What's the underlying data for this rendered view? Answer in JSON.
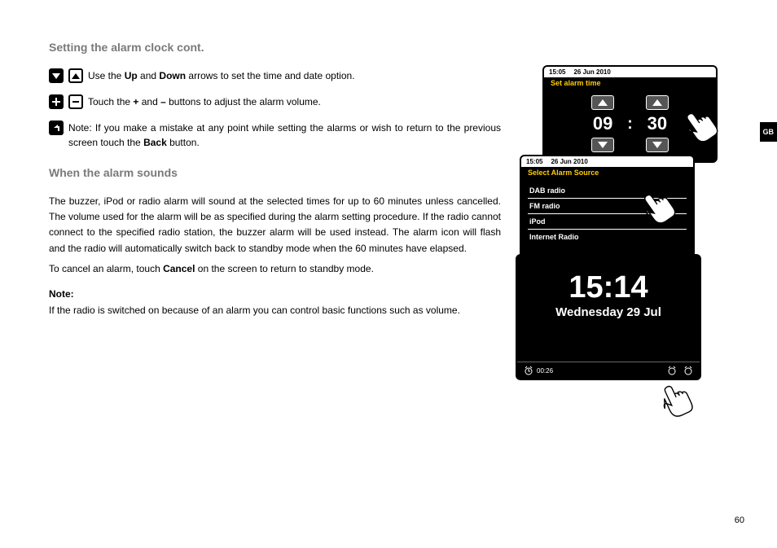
{
  "titles": {
    "section1": "Setting the alarm clock cont.",
    "section2": "When the alarm sounds"
  },
  "instructions": {
    "updown_pre": "Use the ",
    "updown_b1": "Up",
    "updown_mid": " and ",
    "updown_b2": "Down",
    "updown_post": " arrows to set the time and date option.",
    "plusminus_pre": "Touch the ",
    "plusminus_b1": "+",
    "plusminus_mid": " and ",
    "plusminus_b2": "–",
    "plusminus_post": " buttons to adjust the alarm volume.",
    "back_pre": "Note: If you make a mistake at any point while setting the alarms or wish to return to the previous screen touch the ",
    "back_b": "Back",
    "back_post": " button."
  },
  "body": {
    "p1": "The buzzer, iPod or radio alarm will sound at the selected times for up to 60 minutes unless cancelled. The volume used for the alarm will be as specified during the alarm setting procedure. If the radio cannot connect to the specified radio station, the buzzer alarm will be used instead. The alarm icon will flash and the radio will automatically switch back to standby mode when the 60 minutes have elapsed.",
    "p2_pre": "To cancel an alarm, touch ",
    "p2_b": "Cancel",
    "p2_post": " on the screen to return to standby mode.",
    "note_label": "Note:",
    "note_text": "If the radio is switched on because of an alarm you can control basic functions such as volume."
  },
  "page_number": "60",
  "side_tab": "GB",
  "screen1": {
    "status_time": "15:05",
    "status_date": "26 Jun 2010",
    "header": "Set alarm time",
    "hour": "09",
    "minute": "30",
    "colon": ":"
  },
  "screen2": {
    "status_time": "15:05",
    "status_date": "26 Jun 2010",
    "header": "Select Alarm Source",
    "items": [
      "DAB radio",
      "FM radio",
      "iPod",
      "Internet Radio"
    ]
  },
  "screen3": {
    "time": "15:14",
    "date": "Wednesday 29 Jul",
    "footer_time": "00:26"
  }
}
